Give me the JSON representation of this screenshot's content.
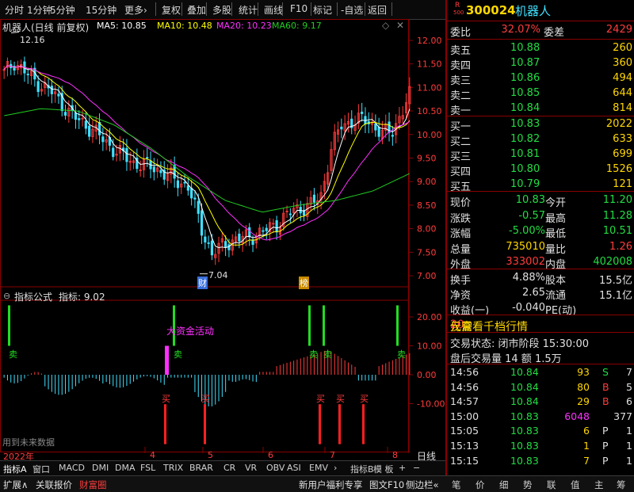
{
  "toolbar": {
    "items": [
      "分时",
      "1分钟",
      "5分钟",
      "15分钟",
      "更多›",
      "复权",
      "叠加",
      "多股",
      "统计",
      "画线",
      "F10",
      "标记",
      "-自选",
      "返回"
    ]
  },
  "main_chart": {
    "title": "机器人(日线 前复权)",
    "ma5": "MA5: 10.85",
    "ma10": "MA10: 10.48",
    "ma20": "MA20: 10.23",
    "ma60": "MA60: 9.17",
    "high_label": "12.16",
    "low_label": "7.04",
    "badge_cai": "财",
    "badge_bang": "榜",
    "yticks": [
      "12.00",
      "11.50",
      "11.00",
      "10.50",
      "10.00",
      "9.50",
      "9.00",
      "8.50",
      "8.00",
      "7.50",
      "7.00"
    ]
  },
  "indicator": {
    "title": "指标公式",
    "value_label": "指标: 9.02",
    "yticks": [
      "20.00",
      "10.00",
      "0.00",
      "-10.00"
    ],
    "annot_big": "大资金活动",
    "sell_label": "卖",
    "buy_label": "买",
    "watermark": "用到未来数据"
  },
  "xaxis": {
    "year": "2022年",
    "months": [
      "4",
      "5",
      "6",
      "7",
      "8"
    ],
    "period": "日线"
  },
  "tabs": [
    "指标A",
    "窗口",
    "MACD",
    "DMI",
    "DMA",
    "FSL",
    "TRIX",
    "BRAR",
    "CR",
    "VR",
    "OBV",
    "ASI",
    "EMV",
    "›",
    "指标B",
    "模 板",
    "+",
    "−"
  ],
  "statusbar": {
    "left": [
      "扩展∧",
      "关联报价",
      "财富圈"
    ],
    "right": [
      "新用户福利专享",
      "图文F10",
      "侧边栏«",
      "笔",
      "价",
      "细",
      "势",
      "联",
      "值",
      "主",
      "筹"
    ]
  },
  "quote": {
    "r_badge": "R",
    "r_sub": "500",
    "code": "300024",
    "name": "机器人",
    "weibi_label": "委比",
    "weibi": "32.07%",
    "weicha_label": "委差",
    "weicha": "2429",
    "asks": [
      {
        "label": "卖五",
        "price": "10.88",
        "vol": "260"
      },
      {
        "label": "卖四",
        "price": "10.87",
        "vol": "360"
      },
      {
        "label": "卖三",
        "price": "10.86",
        "vol": "494"
      },
      {
        "label": "卖二",
        "price": "10.85",
        "vol": "644"
      },
      {
        "label": "卖一",
        "price": "10.84",
        "vol": "814"
      }
    ],
    "bids": [
      {
        "label": "买一",
        "price": "10.83",
        "vol": "2022"
      },
      {
        "label": "买二",
        "price": "10.82",
        "vol": "633"
      },
      {
        "label": "买三",
        "price": "10.81",
        "vol": "699"
      },
      {
        "label": "买四",
        "price": "10.80",
        "vol": "1526"
      },
      {
        "label": "买五",
        "price": "10.79",
        "vol": "121"
      }
    ],
    "stats": [
      {
        "l1": "现价",
        "v1": "10.83",
        "c1": "green",
        "l2": "今开",
        "v2": "11.20",
        "c2": "green"
      },
      {
        "l1": "涨跌",
        "v1": "-0.57",
        "c1": "green",
        "l2": "最高",
        "v2": "11.28",
        "c2": "green"
      },
      {
        "l1": "涨幅",
        "v1": "-5.00%",
        "c1": "green",
        "l2": "最低",
        "v2": "10.51",
        "c2": "green"
      },
      {
        "l1": "总量",
        "v1": "735010",
        "c1": "yellow",
        "l2": "量比",
        "v2": "1.26",
        "c2": "red"
      },
      {
        "l1": "外盘",
        "v1": "333002",
        "c1": "red",
        "l2": "内盘",
        "v2": "402008",
        "c2": "green"
      }
    ],
    "stats2": [
      {
        "l1": "换手",
        "v1": "4.88%",
        "l2": "股本",
        "v2": "15.5亿"
      },
      {
        "l1": "净资",
        "v1": "2.65",
        "l2": "流通",
        "v2": "15.1亿"
      },
      {
        "l1": "收益(一)",
        "v1": "-0.040",
        "l2": "PE(动)",
        "v2": ""
      }
    ],
    "promo_pre": "仅需",
    "promo_num": "20",
    "promo_post": "元查看千档行情",
    "trade_status": "交易状态: 闭市阶段 15:30:00",
    "after_hours": "盘后交易量 14 额 1.5万",
    "ticks": [
      {
        "time": "14:56",
        "price": "10.84",
        "vol": "93",
        "flag": "S",
        "n": "7",
        "vc": "yellow",
        "fc": "green"
      },
      {
        "time": "14:56",
        "price": "10.84",
        "vol": "80",
        "flag": "B",
        "n": "5",
        "vc": "yellow",
        "fc": "red"
      },
      {
        "time": "14:57",
        "price": "10.84",
        "vol": "29",
        "flag": "B",
        "n": "6",
        "vc": "yellow",
        "fc": "red"
      },
      {
        "time": "15:00",
        "price": "10.83",
        "vol": "6048",
        "flag": "",
        "n": "377",
        "vc": "mag",
        "fc": "white"
      },
      {
        "time": "15:05",
        "price": "10.83",
        "vol": "6",
        "flag": "P",
        "n": "1",
        "vc": "yellow",
        "fc": "white"
      },
      {
        "time": "15:13",
        "price": "10.83",
        "vol": "1",
        "flag": "P",
        "n": "1",
        "vc": "yellow",
        "fc": "white"
      },
      {
        "time": "15:15",
        "price": "10.83",
        "vol": "7",
        "flag": "P",
        "n": "1",
        "vc": "yellow",
        "fc": "white"
      }
    ]
  },
  "colors": {
    "up": "#ff3c3c",
    "down": "#40e0ff",
    "ma5": "#ffffff",
    "ma10": "#ffff00",
    "ma20": "#ff30ff",
    "ma60": "#22cc22",
    "grid": "#8a0000"
  }
}
